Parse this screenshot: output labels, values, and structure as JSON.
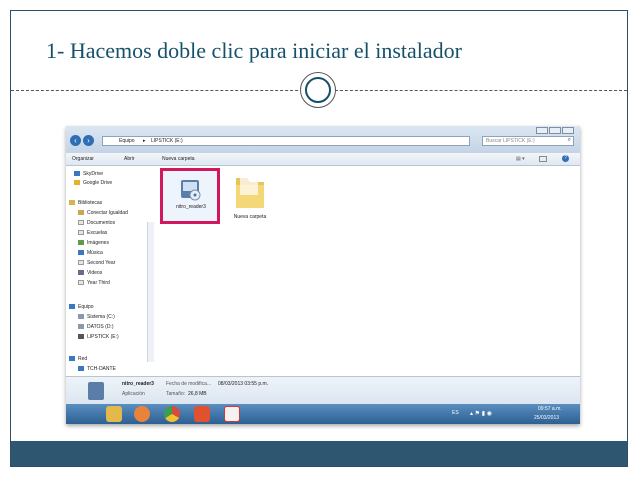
{
  "slide": {
    "title": "1- Hacemos doble clic para iniciar el instalador"
  },
  "explorer": {
    "breadcrumb": [
      "Equipo",
      "LIPSTICK (E:)"
    ],
    "search_placeholder": "Buscar LIPSTICK (E:)",
    "toolbar": {
      "organize": "Organizar",
      "open": "Abrir",
      "new_folder": "Nueva carpeta"
    },
    "nav": {
      "favorites": [
        "SkyDrive",
        "Google Drive"
      ],
      "libraries_header": "Bibliotecas",
      "libraries": [
        "Conectar Igualdad",
        "Documentos",
        "Escuelas",
        "Imágenes",
        "Música",
        "Second Year",
        "Videos",
        "Year Third"
      ],
      "computer_header": "Equipo",
      "drives": [
        "Sistema (C:)",
        "DATOS (D:)",
        "LIPSTICK (E:)"
      ],
      "network_header": "Red",
      "network": [
        "TCH-DANTE"
      ]
    },
    "files": [
      {
        "name": "nitro_reader3",
        "icon": "installer-icon",
        "selected": true
      },
      {
        "name": "Nueva carpeta",
        "icon": "folder-icon",
        "selected": false
      }
    ],
    "details": {
      "name": "nitro_reader3",
      "type": "Aplicación",
      "modified_label": "Fecha de modifica...",
      "modified": "08/03/2013 03:55 p.m.",
      "size_label": "Tamaño:",
      "size": "26,8 MB"
    },
    "taskbar": {
      "lang": "ES",
      "time": "09:57 a.m.",
      "date": "25/03/2013"
    }
  },
  "colors": {
    "title": "#17506a",
    "footer": "#2e5670",
    "highlight": "#d3175c"
  }
}
